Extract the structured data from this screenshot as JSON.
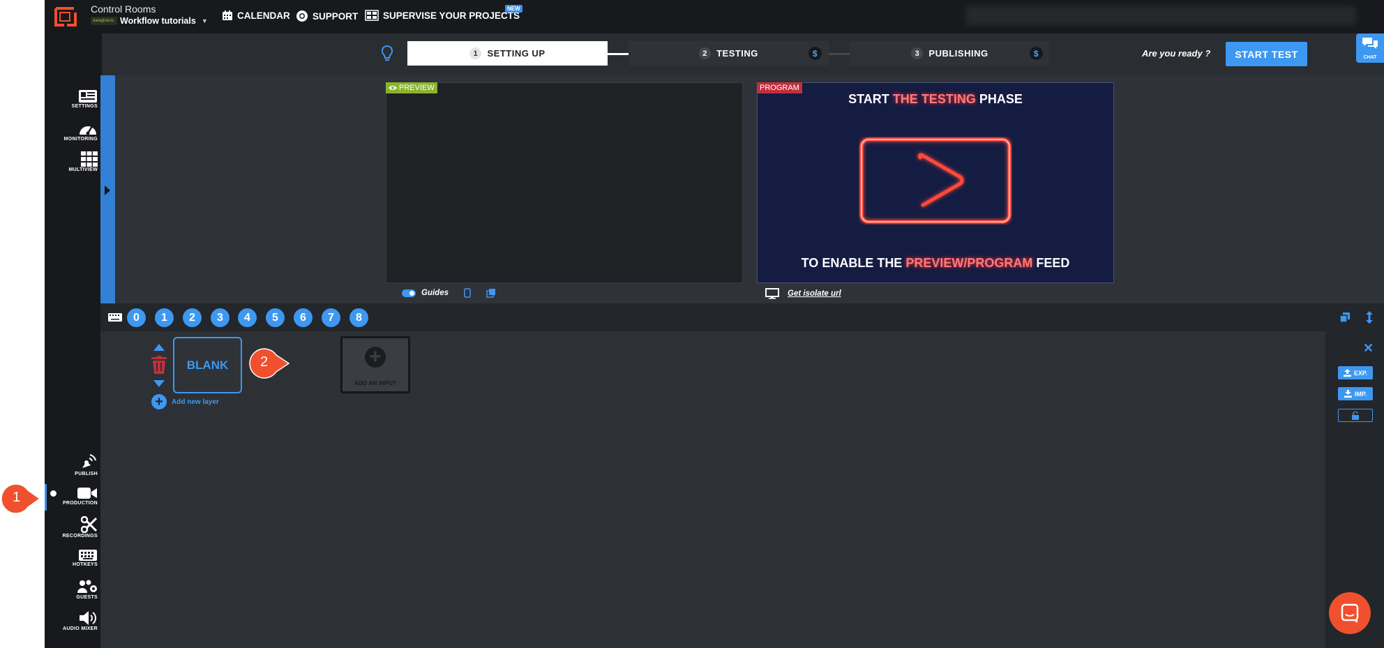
{
  "header": {
    "room_title": "Control Rooms",
    "room_name": "Workflow tutorials",
    "mini_logo_text": "dataglow.io",
    "nav": {
      "calendar": "CALENDAR",
      "support": "SUPPORT",
      "supervise": "SUPERVISE YOUR PROJECTS",
      "new_badge": "NEW"
    }
  },
  "phases": [
    {
      "num": "1",
      "label": "SETTING UP"
    },
    {
      "num": "2",
      "label": "TESTING",
      "badge": "$"
    },
    {
      "num": "3",
      "label": "PUBLISHING",
      "badge": "$"
    }
  ],
  "ready_text": "Are you ready ?",
  "start_test_label": "START TEST",
  "chat_label": "CHAT",
  "sidebar_top": [
    {
      "label": "SETTINGS",
      "icon": "settings-icon"
    },
    {
      "label": "MONITORING",
      "icon": "gauge-icon"
    },
    {
      "label": "MULTIVIEW",
      "icon": "grid-icon"
    }
  ],
  "sidebar_bottom": [
    {
      "label": "PUBLISH",
      "icon": "broadcast-icon"
    },
    {
      "label": "PRODUCTION",
      "icon": "video-camera-icon"
    },
    {
      "label": "RECORDINGS",
      "icon": "scissors-icon"
    },
    {
      "label": "HOTKEYS",
      "icon": "keyboard-icon"
    },
    {
      "label": "GUESTS",
      "icon": "guests-icon"
    },
    {
      "label": "AUDIO MIXER",
      "icon": "speaker-icon"
    }
  ],
  "preview": {
    "tag": "PREVIEW",
    "guides_label": "Guides"
  },
  "program": {
    "tag": "PROGRAM",
    "line1_pre": "START ",
    "line1_hl": "THE TESTING",
    "line1_post": " PHASE",
    "line2_pre": "TO ENABLE THE ",
    "line2_hl": "PREVIEW/PROGRAM",
    "line2_post": " FEED",
    "isolate_label": "Get isolate url"
  },
  "scenes": [
    "0",
    "1",
    "2",
    "3",
    "4",
    "5",
    "6",
    "7",
    "8"
  ],
  "layer": {
    "blank_label": "BLANK",
    "add_input_label": "ADD AN INPUT",
    "add_layer_label": "Add new layer"
  },
  "right_panel": {
    "export_label": "EXP.",
    "import_label": "IMP."
  },
  "callouts": [
    "1",
    "2"
  ],
  "colors": {
    "accent": "#3d98f2",
    "preview_tag": "#8ab32f",
    "program_tag": "#c0303d",
    "callout": "#f0502d"
  }
}
